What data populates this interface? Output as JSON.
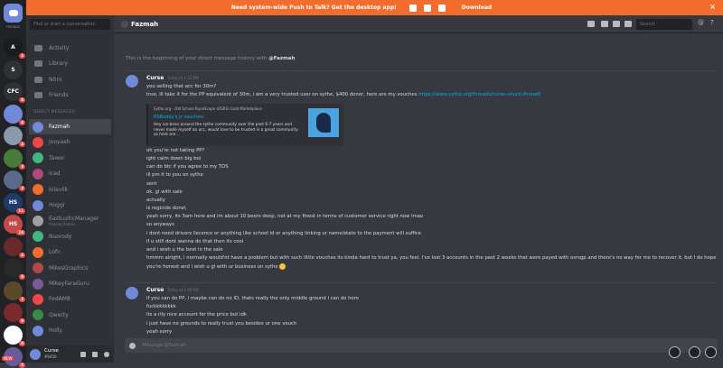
{
  "banner": {
    "text": "Need system-wide Push to Talk? Get the desktop app!",
    "download": "Download",
    "close": "×"
  },
  "guilds": {
    "home_label": "FRIENDS",
    "items": [
      {
        "name": "A",
        "color": "#1b1c1f",
        "badge": "2"
      },
      {
        "name": "S",
        "color": "#2f3136",
        "badge": ""
      },
      {
        "name": "CFC",
        "color": "#2f3136",
        "badge": "8"
      },
      {
        "name": "",
        "color": "#7289da",
        "badge": "4"
      },
      {
        "name": "",
        "color": "#8a9aaa",
        "badge": "2"
      },
      {
        "name": "",
        "color": "#4a7a3a",
        "badge": "3"
      },
      {
        "name": "",
        "color": "#5a6a8a",
        "badge": "3"
      },
      {
        "name": "HS",
        "color": "#1f3b6b",
        "badge": "11"
      },
      {
        "name": "HS",
        "color": "#c04a4a",
        "badge": "10"
      },
      {
        "name": "",
        "color": "#6a2a2a",
        "badge": "4"
      },
      {
        "name": "",
        "color": "#2a2a2a",
        "badge": "8"
      },
      {
        "name": "",
        "color": "#5a4a2a",
        "badge": "2"
      },
      {
        "name": "",
        "color": "#7a2a2a",
        "badge": "8"
      },
      {
        "name": "",
        "color": "#ffffff",
        "badge": "8"
      },
      {
        "name": "",
        "color": "#6a5a9a",
        "badge": "5"
      }
    ],
    "new_badge": "NEW"
  },
  "dm_search_placeholder": "Find or start a conversation",
  "nav": [
    "Activity",
    "Library",
    "Nitro",
    "Friends"
  ],
  "dm_header": "DIRECT MESSAGES",
  "dms": [
    {
      "name": "Fazmah",
      "sub": "",
      "color": "#7289da",
      "selected": true
    },
    {
      "name": "jooyaeh",
      "sub": "",
      "color": "#f04747"
    },
    {
      "name": "Tawer",
      "sub": "",
      "color": "#43b581"
    },
    {
      "name": "Icad",
      "sub": "",
      "color": "#b04a7a"
    },
    {
      "name": "bilavlik",
      "sub": "",
      "color": "#f26c2e"
    },
    {
      "name": "Hoggi",
      "sub": "",
      "color": "#7289da"
    },
    {
      "name": "EastLuiticManager",
      "sub": "Playing Roblox",
      "color": "#a0a0a0"
    },
    {
      "name": "Nuorody",
      "sub": "",
      "color": "#43b581"
    },
    {
      "name": "Lofn",
      "sub": "",
      "color": "#f26c2e"
    },
    {
      "name": "MikesGraphics",
      "sub": "",
      "color": "#b04a4a"
    },
    {
      "name": "MikeyFaraGuru",
      "sub": "",
      "color": "#7a5a9a"
    },
    {
      "name": "FedAM8",
      "sub": "",
      "color": "#f04747"
    },
    {
      "name": "Qwerty",
      "sub": "",
      "color": "#3a8a4a"
    },
    {
      "name": "Holly",
      "sub": "",
      "color": "#7289da"
    }
  ],
  "user": {
    "name": "Curse",
    "tag": "#6450"
  },
  "chat": {
    "recipient": "Fazmah",
    "search_placeholder": "Search",
    "beginning": "This is the beginning of your direct message history with ",
    "beginning_name": "@Fazmah",
    "input_placeholder": "Message @Fazmah"
  },
  "messages": [
    {
      "author": "Curse",
      "timestamp": "Today at 1:31 PM",
      "lines": [
        "you selling that acc for 30m?",
        "true, ill take it for the PP equivalent of 30m, i am a very trusted user on sythe, $400 donor, here are my vouches ",
        "oh you're not taking PP?",
        "ight calm down big boi",
        "can do btc if you agree to my TOS",
        "ill pm it to you on sythe",
        "sent",
        "ok, gl with sale",
        "actually",
        "is regicide done\\",
        "yeah sorry, its 3am here and im about 10 beers deep, not at my finest in terms of customer service right now lmao",
        "so anyways",
        "i dont need drivers liscence or anything like school id or anything linking ur name/state to the payment will suffice",
        "if u still dont wanna do that then its cool",
        "and i wish u the best in the sale",
        "hmmm alright, i normally would'nt have a problem but with such little vouches its kinda hard to trust ya, you feel. i've lost 3 accounts in the past 2 weeks that were payed with osrsgp and there's no way for me to recover it, but I do hope",
        "you're honest and i wish u gl with ur business on sythe "
      ],
      "link": "https://www.sythe.org/threads/curse-vouch-thread/",
      "embed": {
        "provider": "Sythe.org - Old School RuneScape (OSRS) Gold Marketplace",
        "title": "RSBuddy's Jr vouches!",
        "desc": "Hey ive been around the sythe community over the past 6-7 years and never made myself an acc, would love to be trusted in a great community as here are..."
      }
    },
    {
      "author": "Curse",
      "timestamp": "Today at 1:40 PM",
      "lines": [
        "if you can do PP, i maybe can do no ID, thats really the only middle ground i can do here",
        "fuckkkkkkkk",
        "its a rlly nice account for the price but idk",
        "i just have no grounds to really trust you besides ur one vouch",
        "yeah sorry"
      ]
    }
  ]
}
